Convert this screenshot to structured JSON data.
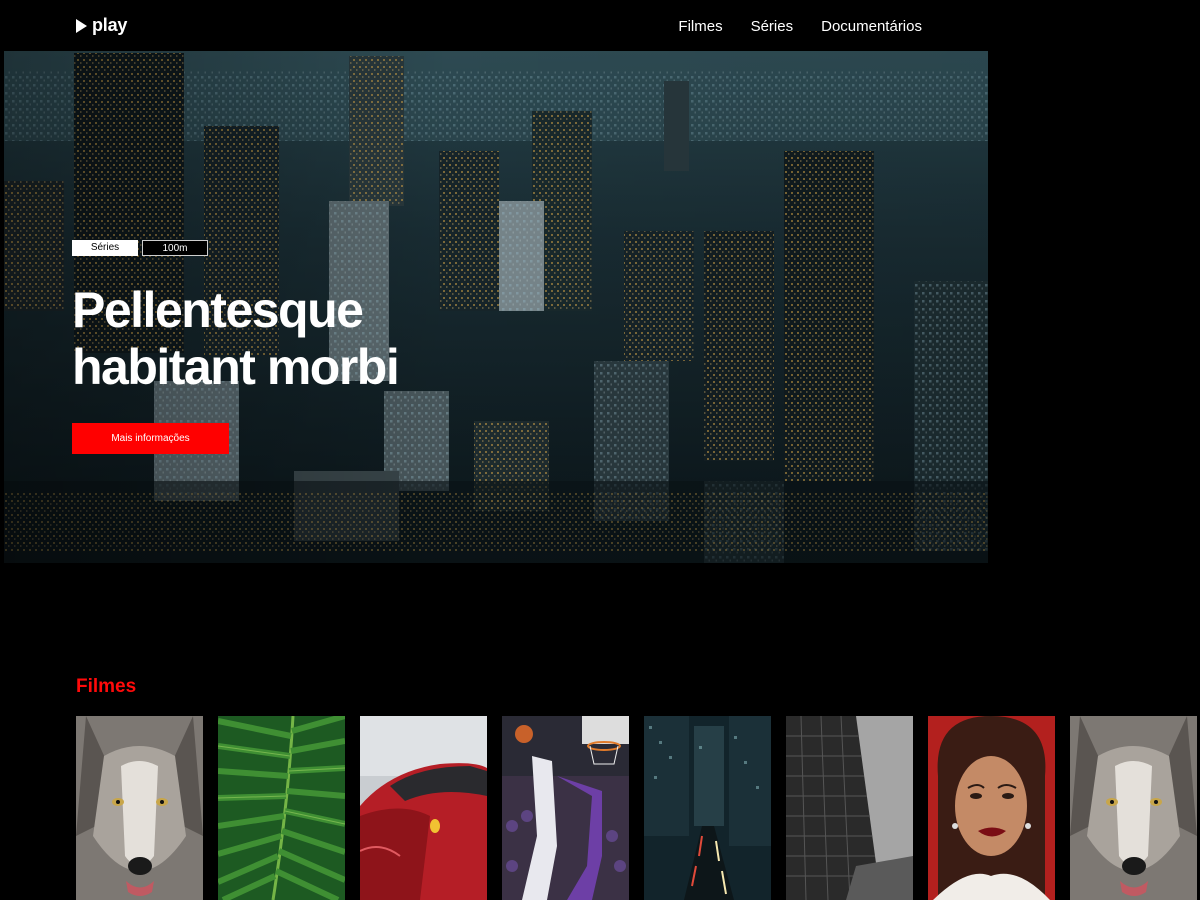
{
  "header": {
    "logo_text": "play",
    "nav": [
      {
        "label": "Filmes"
      },
      {
        "label": "Séries"
      },
      {
        "label": "Documentários"
      }
    ]
  },
  "hero": {
    "tag_category": "Séries",
    "tag_duration": "100m",
    "title_line1": "Pellentesque",
    "title_line2": "habitant morbi",
    "cta_label": "Mais informações",
    "image_subject": "aerial city skyline at dusk"
  },
  "row": {
    "title": "Filmes",
    "posters": [
      {
        "subject": "wolf"
      },
      {
        "subject": "palm leaves"
      },
      {
        "subject": "red sports car"
      },
      {
        "subject": "basketball players"
      },
      {
        "subject": "city street at night"
      },
      {
        "subject": "skyscraper black and white"
      },
      {
        "subject": "woman portrait"
      },
      {
        "subject": "wolf"
      }
    ]
  },
  "colors": {
    "accent": "#ff0000",
    "background": "#000000"
  }
}
